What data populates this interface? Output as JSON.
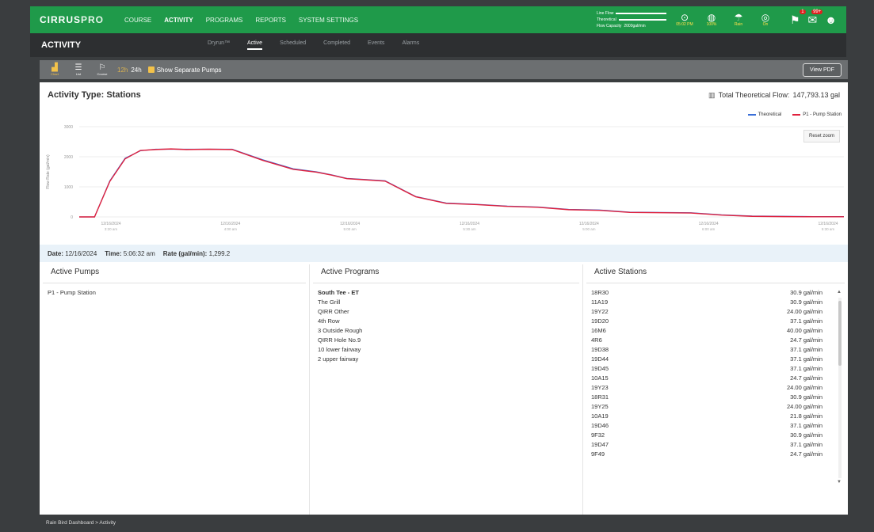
{
  "app": {
    "logo_main": "CIRRUS",
    "logo_pro": "PRO",
    "nav": [
      "COURSE",
      "ACTIVITY",
      "PROGRAMS",
      "REPORTS",
      "SYSTEM SETTINGS"
    ],
    "active_nav": "ACTIVITY"
  },
  "topbar_legend": {
    "row1": "Line Flow",
    "row2": "Theoretical",
    "row3": "Flow Capacity",
    "row3_value": "2000gal/min"
  },
  "status": [
    {
      "icon": "gauge-icon",
      "glyph": "⊙",
      "label": "05:02 PM"
    },
    {
      "icon": "droplet-icon",
      "glyph": "◍",
      "label": "100%"
    },
    {
      "icon": "rain-icon",
      "glyph": "☂",
      "label": "Rain"
    },
    {
      "icon": "signal-icon",
      "glyph": "◎",
      "label": "On"
    }
  ],
  "notifications": {
    "alerts_count": "1",
    "messages_count": "99+"
  },
  "page": {
    "title": "ACTIVITY",
    "tabs": [
      "Dryrun™",
      "Active",
      "Scheduled",
      "Completed",
      "Events",
      "Alarms"
    ],
    "active_tab": "Active"
  },
  "toolbar": {
    "tools": [
      {
        "label": "Chart",
        "glyph": "▟"
      },
      {
        "label": "List",
        "glyph": "☰"
      },
      {
        "label": "Course",
        "glyph": "⚐"
      }
    ],
    "range_12": "12h",
    "range_24": "24h",
    "separate_pumps": "Show Separate Pumps",
    "view_pdf": "View PDF"
  },
  "activity": {
    "title": "Activity Type: Stations",
    "total_flow_label": "Total Theoretical Flow:",
    "total_flow_value": "147,793.13 gal"
  },
  "chart_data": {
    "type": "line",
    "ylabel": "Flow Rate (gal/min)",
    "ylim": [
      0,
      3000
    ],
    "yticks": [
      0,
      1000,
      2000,
      3000
    ],
    "xtick_labels": [
      [
        "12/16/2024",
        "3:20 am"
      ],
      [
        "12/16/2024",
        "4:00 am"
      ],
      [
        "12/16/2024",
        "5:00 am"
      ],
      [
        "12/16/2024",
        "5:30 am"
      ],
      [
        "12/16/2024",
        "5:00 am"
      ],
      [
        "12/16/2024",
        "6:00 am"
      ],
      [
        "12/16/2024",
        "5:30 am"
      ]
    ],
    "legend": [
      {
        "name": "Theoretical",
        "color": "#3b6fd8"
      },
      {
        "name": "P1 - Pump Station",
        "color": "#e0213d"
      }
    ],
    "series": [
      {
        "name": "Theoretical",
        "x": [
          0,
          2,
          4,
          6,
          8,
          10,
          12,
          14,
          17,
          20,
          24,
          28,
          31,
          33,
          35,
          37,
          40,
          44,
          48,
          52,
          56,
          60,
          64,
          68,
          72,
          76,
          80,
          84,
          88,
          92,
          96,
          100
        ],
        "y": [
          0,
          0,
          1200,
          1950,
          2200,
          2250,
          2250,
          2250,
          2250,
          2250,
          1900,
          1600,
          1500,
          1400,
          1280,
          1250,
          1200,
          680,
          460,
          420,
          360,
          330,
          250,
          230,
          160,
          150,
          140,
          70,
          30,
          20,
          10,
          10
        ]
      },
      {
        "name": "P1 - Pump Station",
        "x": [
          0,
          2,
          4,
          6,
          8,
          10,
          12,
          14,
          17,
          20,
          24,
          28,
          31,
          33,
          35,
          37,
          40,
          44,
          48,
          52,
          56,
          60,
          64,
          68,
          72,
          76,
          80,
          84,
          88,
          92,
          96,
          100
        ],
        "y": [
          0,
          0,
          1180,
          1930,
          2210,
          2240,
          2260,
          2240,
          2250,
          2240,
          1880,
          1580,
          1490,
          1390,
          1270,
          1240,
          1190,
          670,
          450,
          410,
          350,
          320,
          240,
          220,
          150,
          140,
          130,
          60,
          20,
          10,
          5,
          5
        ]
      }
    ],
    "reset_zoom": "Reset zoom"
  },
  "readout": {
    "date_label": "Date:",
    "date_value": "12/16/2024",
    "time_label": "Time:",
    "time_value": "5:06:32 am",
    "rate_label": "Rate (gal/min):",
    "rate_value": "1,299.2"
  },
  "pumps": {
    "header": "Active Pumps",
    "items": [
      "P1 - Pump Station"
    ]
  },
  "programs": {
    "header": "Active Programs",
    "items": [
      "South Tee - ET",
      "The Grill",
      "QIRR Other",
      "4th Row",
      "3 Outside Rough",
      "QIRR Hole No.9",
      "10 lower fairway",
      "2 upper fairway"
    ]
  },
  "stations": {
    "header": "Active Stations",
    "items": [
      {
        "name": "18R30",
        "rate": "30.9 gal/min"
      },
      {
        "name": "11A19",
        "rate": "30.9 gal/min"
      },
      {
        "name": "19Y22",
        "rate": "24.00 gal/min"
      },
      {
        "name": "19D20",
        "rate": "37.1 gal/min"
      },
      {
        "name": "16M6",
        "rate": "40.00 gal/min"
      },
      {
        "name": "4R6",
        "rate": "24.7 gal/min"
      },
      {
        "name": "19D38",
        "rate": "37.1 gal/min"
      },
      {
        "name": "19D44",
        "rate": "37.1 gal/min"
      },
      {
        "name": "19D45",
        "rate": "37.1 gal/min"
      },
      {
        "name": "10A15",
        "rate": "24.7 gal/min"
      },
      {
        "name": "19Y23",
        "rate": "24.00 gal/min"
      },
      {
        "name": "18R31",
        "rate": "30.9 gal/min"
      },
      {
        "name": "19Y25",
        "rate": "24.00 gal/min"
      },
      {
        "name": "10A19",
        "rate": "21.8 gal/min"
      },
      {
        "name": "19D46",
        "rate": "37.1 gal/min"
      },
      {
        "name": "9F32",
        "rate": "30.9 gal/min"
      },
      {
        "name": "19D47",
        "rate": "37.1 gal/min"
      },
      {
        "name": "9F49",
        "rate": "24.7 gal/min"
      }
    ]
  },
  "footer": {
    "breadcrumb": "Rain Bird Dashboard > Activity"
  }
}
